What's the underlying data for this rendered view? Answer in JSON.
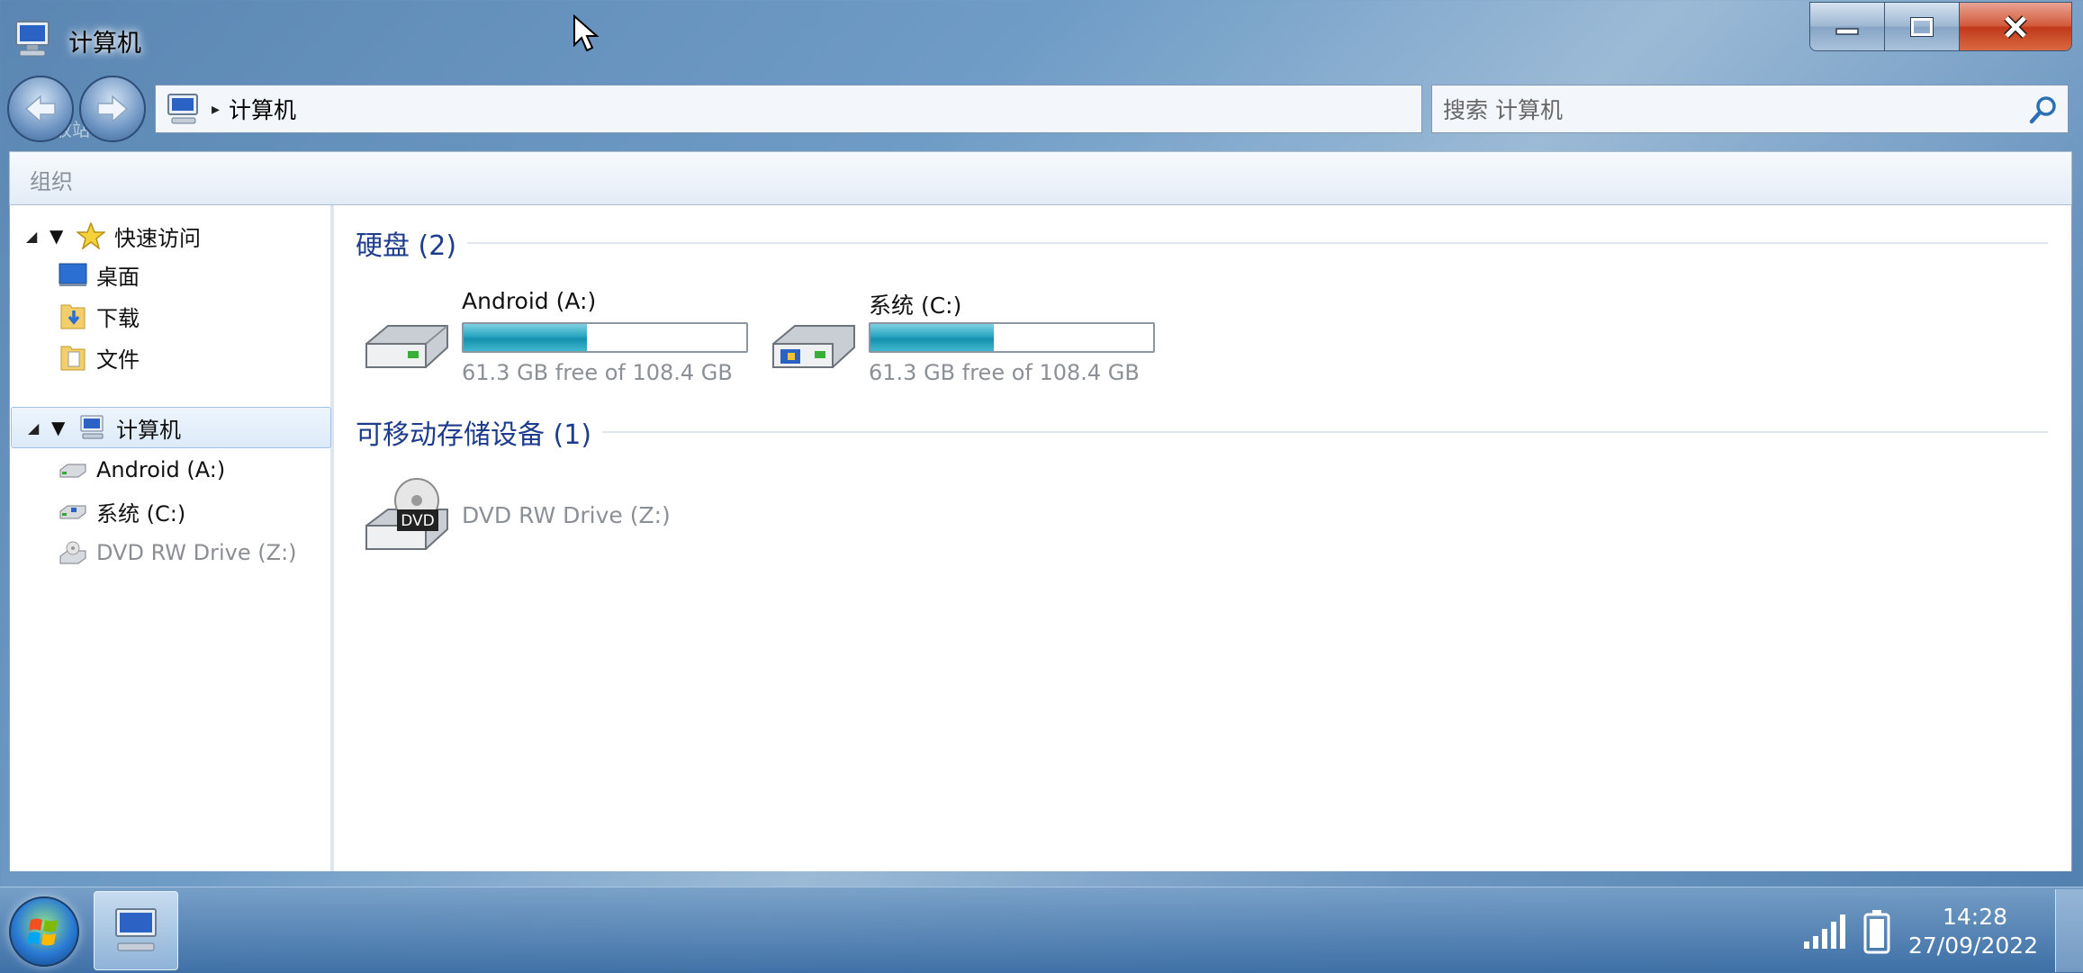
{
  "window": {
    "title": "计算机",
    "ghost_label": "回收站"
  },
  "address": {
    "crumb": "计算机"
  },
  "search": {
    "placeholder": "搜索 计算机"
  },
  "toolbar": {
    "organize": "组织"
  },
  "sidebar": {
    "quick_access": "快速访问",
    "desktop": "桌面",
    "downloads": "下载",
    "documents": "文件",
    "computer": "计算机",
    "drive_a": "Android (A:)",
    "drive_c": "系统 (C:)",
    "drive_z": "DVD RW Drive (Z:)"
  },
  "groups": {
    "hard_disks": "硬盘 (2)",
    "removable": "可移动存储设备 (1)"
  },
  "drives": [
    {
      "name": "Android (A:)",
      "free_text": "61.3 GB free of 108.4 GB",
      "used_fraction": 0.435
    },
    {
      "name": "系统 (C:)",
      "free_text": "61.3 GB free of 108.4 GB",
      "used_fraction": 0.435
    }
  ],
  "removable_drives": [
    {
      "name": "DVD RW Drive (Z:)",
      "icon_text": "DVD"
    }
  ],
  "taskbar": {
    "time": "14:28",
    "date": "27/09/2022"
  },
  "colors": {
    "group_header": "#1e3c8c",
    "usage_bar": "#2aa6c2",
    "close_button": "#c0391b"
  }
}
